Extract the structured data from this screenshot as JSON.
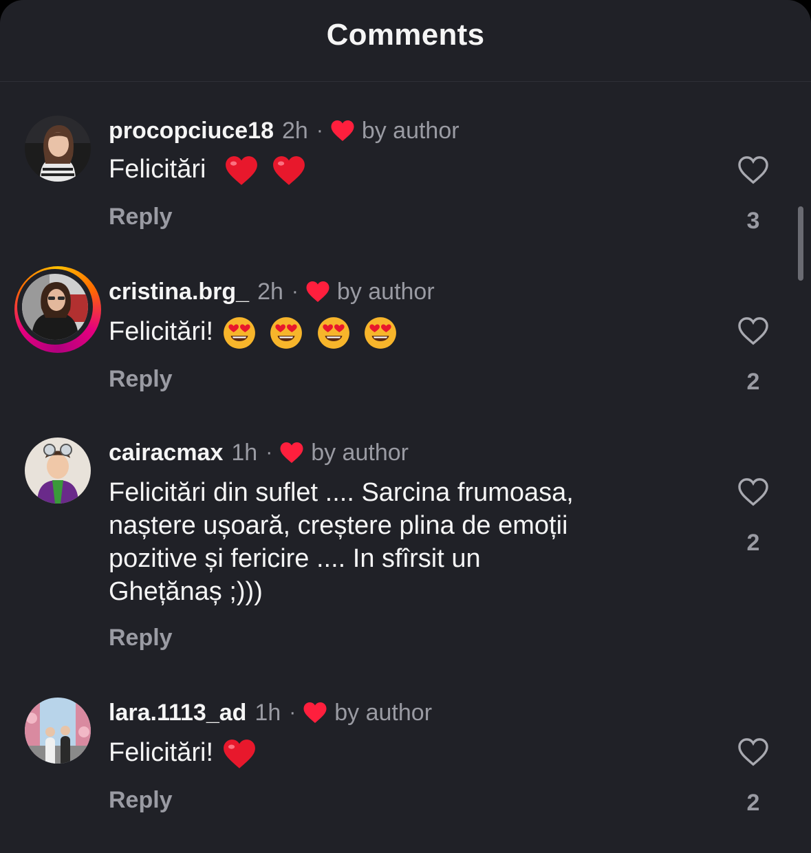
{
  "header": {
    "title": "Comments"
  },
  "labels": {
    "by_author": "by author",
    "reply": "Reply",
    "dot": "·"
  },
  "colors": {
    "background": "#202127",
    "primary_text": "#f5f5f5",
    "secondary_text": "#9a9ba3",
    "heart_red": "#ff1f3d",
    "story_ring": [
      "#ffbf00",
      "#ff6a00",
      "#e6007e"
    ]
  },
  "comments": [
    {
      "username": "procopciuce18",
      "time": "2h",
      "liked_by_author": true,
      "text": "Felicitări",
      "emojis": [
        "red-heart-emoji",
        "red-heart-emoji"
      ],
      "likes": "3",
      "story_ring": false
    },
    {
      "username": "cristina.brg_",
      "time": "2h",
      "liked_by_author": true,
      "text": "Felicitări!",
      "emojis": [
        "heart-eyes-emoji",
        "heart-eyes-emoji",
        "heart-eyes-emoji",
        "heart-eyes-emoji"
      ],
      "likes": "2",
      "story_ring": true
    },
    {
      "username": "cairacmax",
      "time": "1h",
      "liked_by_author": true,
      "text_lines": [
        "Felicitări din suflet .... Sarcina frumoasa,",
        "naștere ușoară, creștere plina de emoții",
        "pozitive și fericire .... In sfîrsit un",
        "Ghețănaș ;)))"
      ],
      "likes": "2",
      "story_ring": false
    },
    {
      "username": "lara.1113_ad",
      "time": "1h",
      "liked_by_author": true,
      "text": "Felicitări!",
      "emojis": [
        "red-heart-emoji"
      ],
      "likes": "2",
      "story_ring": false
    }
  ]
}
